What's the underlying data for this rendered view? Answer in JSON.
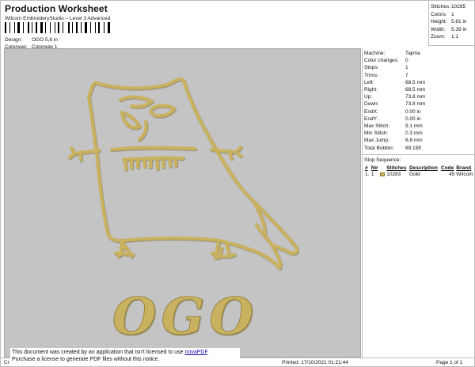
{
  "header": {
    "title": "Production Worksheet",
    "subtitle": "Wilcom EmbroideryStudio – Level 3 Advanced",
    "design_label": "Design:",
    "design_value": "OGO 5,8 in",
    "colorway_label": "Colorway:",
    "colorway_value": "Colorway 1"
  },
  "stats": [
    {
      "label": "Stitches:",
      "value": "10285"
    },
    {
      "label": "Colors:",
      "value": "1"
    },
    {
      "label": "Height:",
      "value": "5.81 in"
    },
    {
      "label": "Width:",
      "value": "5.39 in"
    },
    {
      "label": "Zoom:",
      "value": "1:1"
    }
  ],
  "machine": [
    {
      "label": "Machine:",
      "value": "Tajima"
    },
    {
      "label": "Color changes:",
      "value": "0"
    },
    {
      "label": "Stops:",
      "value": "1"
    },
    {
      "label": "Trims:",
      "value": "7"
    },
    {
      "label": "Left:",
      "value": "68.5 mm"
    },
    {
      "label": "Right:",
      "value": "68.5 mm"
    },
    {
      "label": "Up:",
      "value": "73.8 mm"
    },
    {
      "label": "Down:",
      "value": "73.8 mm"
    },
    {
      "label": "EndX:",
      "value": "0.00 in"
    },
    {
      "label": "EndY:",
      "value": "0.00 in"
    },
    {
      "label": "Max Stitch:",
      "value": "9.1 mm"
    },
    {
      "label": "Min Stitch:",
      "value": "0.3 mm"
    },
    {
      "label": "Max Jump:",
      "value": "6.8 mm"
    },
    {
      "label": "Total Bobbin:",
      "value": "69.15ft"
    }
  ],
  "stop_sequence": {
    "heading": "Stop Sequence:",
    "columns": [
      "#",
      "N#",
      "",
      "Stitches",
      "Description",
      "Code",
      "Brand"
    ],
    "rows": [
      {
        "num": "1.",
        "n": "1",
        "stitches": "10283",
        "description": "Gold",
        "code": "45",
        "brand": "Wilcom"
      }
    ]
  },
  "design_text": "OGO",
  "colors": {
    "thread": "#c9b25e",
    "thread_dark": "#8f7a32",
    "background": "#c4c4c4"
  },
  "footer": {
    "left": "Cr",
    "printed": "Printed: 17/10/2021 01:21:44",
    "page": "Page 1 of 1"
  },
  "notice": {
    "line1": "This document was created by an application that isn't licensed to use",
    "link": "novaPDF",
    "line1_end": ".",
    "line2": "Purchase a license to generate PDF files without this notice."
  }
}
